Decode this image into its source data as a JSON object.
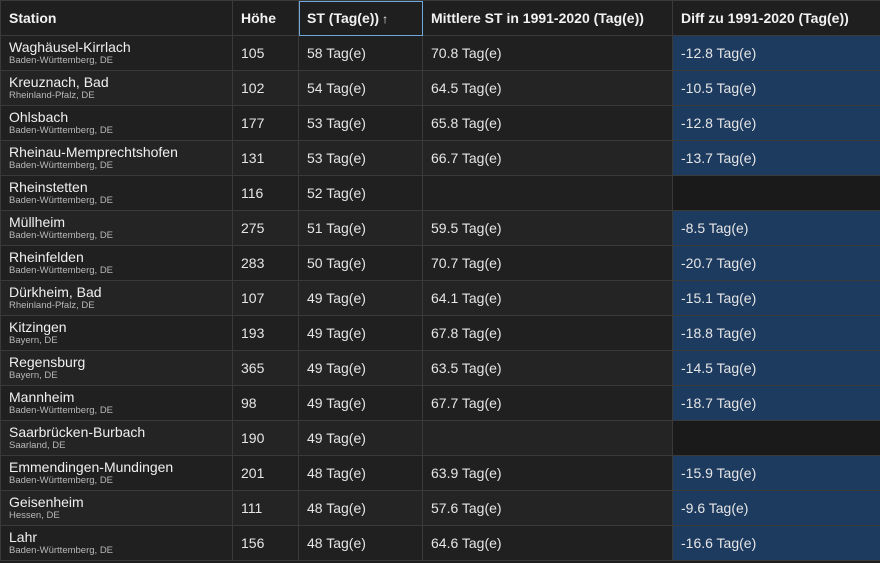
{
  "columns": {
    "station": "Station",
    "hoehe": "Höhe",
    "st": "ST (Tag(e))",
    "st_sort_icon": "↑",
    "mittel": "Mittlere ST in 1991-2020 (Tag(e))",
    "diff": "Diff zu 1991-2020 (Tag(e))"
  },
  "rows": [
    {
      "name": "Waghäusel-Kirrlach",
      "region": "Baden-Württemberg, DE",
      "hoehe": "105",
      "st": "58 Tag(e)",
      "mittel": "70.8 Tag(e)",
      "diff": "-12.8 Tag(e)"
    },
    {
      "name": "Kreuznach, Bad",
      "region": "Rheinland-Pfalz, DE",
      "hoehe": "102",
      "st": "54 Tag(e)",
      "mittel": "64.5 Tag(e)",
      "diff": "-10.5 Tag(e)"
    },
    {
      "name": "Ohlsbach",
      "region": "Baden-Württemberg, DE",
      "hoehe": "177",
      "st": "53 Tag(e)",
      "mittel": "65.8 Tag(e)",
      "diff": "-12.8 Tag(e)"
    },
    {
      "name": "Rheinau-Memprechtshofen",
      "region": "Baden-Württemberg, DE",
      "hoehe": "131",
      "st": "53 Tag(e)",
      "mittel": "66.7 Tag(e)",
      "diff": "-13.7 Tag(e)"
    },
    {
      "name": "Rheinstetten",
      "region": "Baden-Württemberg, DE",
      "hoehe": "116",
      "st": "52 Tag(e)",
      "mittel": "",
      "diff": ""
    },
    {
      "name": "Müllheim",
      "region": "Baden-Württemberg, DE",
      "hoehe": "275",
      "st": "51 Tag(e)",
      "mittel": "59.5 Tag(e)",
      "diff": "-8.5 Tag(e)"
    },
    {
      "name": "Rheinfelden",
      "region": "Baden-Württemberg, DE",
      "hoehe": "283",
      "st": "50 Tag(e)",
      "mittel": "70.7 Tag(e)",
      "diff": "-20.7 Tag(e)"
    },
    {
      "name": "Dürkheim, Bad",
      "region": "Rheinland-Pfalz, DE",
      "hoehe": "107",
      "st": "49 Tag(e)",
      "mittel": "64.1 Tag(e)",
      "diff": "-15.1 Tag(e)"
    },
    {
      "name": "Kitzingen",
      "region": "Bayern, DE",
      "hoehe": "193",
      "st": "49 Tag(e)",
      "mittel": "67.8 Tag(e)",
      "diff": "-18.8 Tag(e)"
    },
    {
      "name": "Regensburg",
      "region": "Bayern, DE",
      "hoehe": "365",
      "st": "49 Tag(e)",
      "mittel": "63.5 Tag(e)",
      "diff": "-14.5 Tag(e)"
    },
    {
      "name": "Mannheim",
      "region": "Baden-Württemberg, DE",
      "hoehe": "98",
      "st": "49 Tag(e)",
      "mittel": "67.7 Tag(e)",
      "diff": "-18.7 Tag(e)"
    },
    {
      "name": "Saarbrücken-Burbach",
      "region": "Saarland, DE",
      "hoehe": "190",
      "st": "49 Tag(e)",
      "mittel": "",
      "diff": ""
    },
    {
      "name": "Emmendingen-Mundingen",
      "region": "Baden-Württemberg, DE",
      "hoehe": "201",
      "st": "48 Tag(e)",
      "mittel": "63.9 Tag(e)",
      "diff": "-15.9 Tag(e)"
    },
    {
      "name": "Geisenheim",
      "region": "Hessen, DE",
      "hoehe": "111",
      "st": "48 Tag(e)",
      "mittel": "57.6 Tag(e)",
      "diff": "-9.6 Tag(e)"
    },
    {
      "name": "Lahr",
      "region": "Baden-Württemberg, DE",
      "hoehe": "156",
      "st": "48 Tag(e)",
      "mittel": "64.6 Tag(e)",
      "diff": "-16.6 Tag(e)"
    }
  ],
  "colors": {
    "background": "#1f1f1f",
    "diff_cell": "#1d3a5f",
    "sorted_outline": "#6fa8dc"
  }
}
